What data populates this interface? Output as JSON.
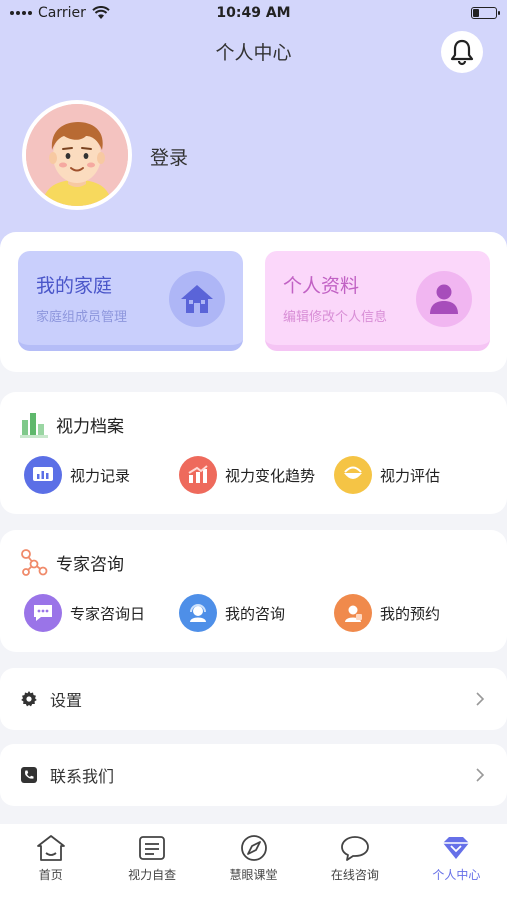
{
  "status_bar": {
    "carrier": "Carrier",
    "time": "10:49 AM",
    "battery_level": 0.25
  },
  "header": {
    "title": "个人中心"
  },
  "user": {
    "login_label": "登录"
  },
  "cards": [
    {
      "title": "我的家庭",
      "subtitle": "家庭组成员管理",
      "icon": "home-icon"
    },
    {
      "title": "个人资料",
      "subtitle": "编辑修改个人信息",
      "icon": "user-icon"
    }
  ],
  "vision_section": {
    "title": "视力档案",
    "items": [
      {
        "label": "视力记录",
        "icon": "chart-record-icon"
      },
      {
        "label": "视力变化趋势",
        "icon": "trend-icon"
      },
      {
        "label": "视力评估",
        "icon": "assessment-icon"
      }
    ]
  },
  "expert_section": {
    "title": "专家咨询",
    "items": [
      {
        "label": "专家咨询日",
        "icon": "chat-bubble-icon"
      },
      {
        "label": "我的咨询",
        "icon": "consult-icon"
      },
      {
        "label": "我的预约",
        "icon": "appointment-icon"
      }
    ]
  },
  "rows": [
    {
      "label": "设置",
      "icon": "gear-icon"
    },
    {
      "label": "联系我们",
      "icon": "phone-icon"
    }
  ],
  "tabs": [
    {
      "label": "首页",
      "icon": "home-tab-icon"
    },
    {
      "label": "视力自查",
      "icon": "self-check-icon"
    },
    {
      "label": "慧眼课堂",
      "icon": "compass-icon"
    },
    {
      "label": "在线咨询",
      "icon": "chat-icon"
    },
    {
      "label": "个人中心",
      "icon": "diamond-icon",
      "active": true
    }
  ],
  "colors": {
    "header_bg": "#d3d6fb",
    "accent": "#6670e8"
  }
}
